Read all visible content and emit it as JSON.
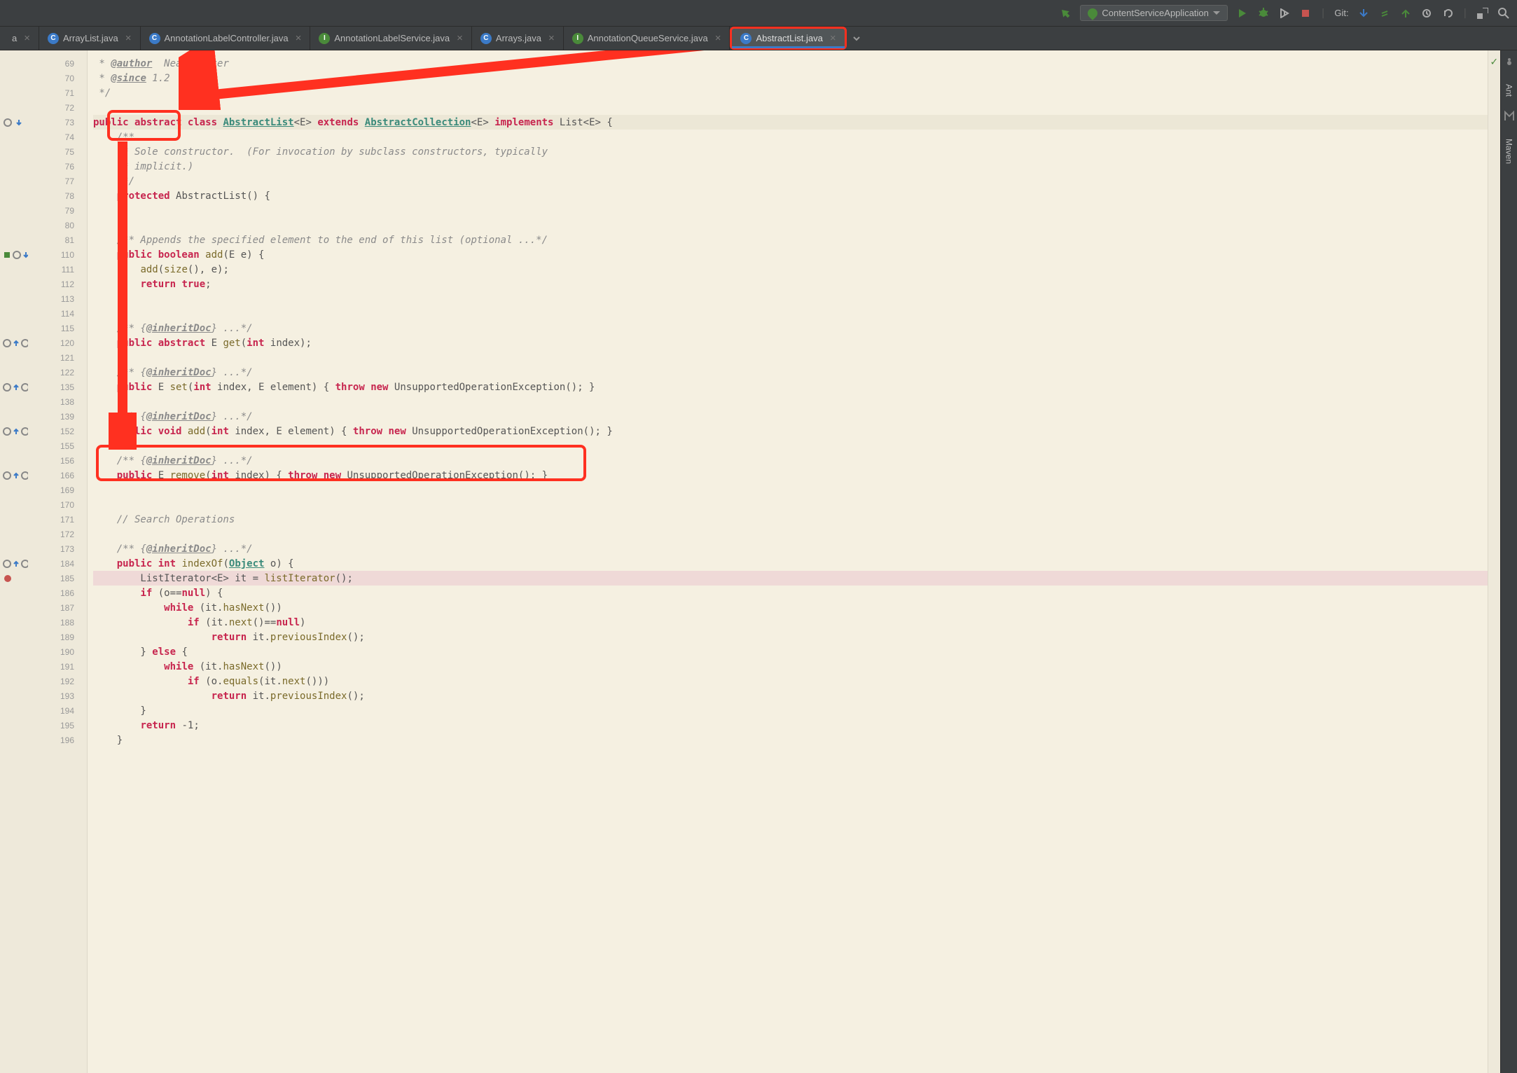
{
  "toolbar": {
    "run_config": "ContentServiceApplication",
    "git_label": "Git:"
  },
  "tabs": [
    {
      "icon": "c",
      "label": "a"
    },
    {
      "icon": "c",
      "label": "ArrayList.java"
    },
    {
      "icon": "c",
      "label": "AnnotationLabelController.java"
    },
    {
      "icon": "i",
      "label": "AnnotationLabelService.java"
    },
    {
      "icon": "c",
      "label": "Arrays.java"
    },
    {
      "icon": "i",
      "label": "AnnotationQueueService.java"
    },
    {
      "icon": "c",
      "label": "AbstractList.java"
    }
  ],
  "sidebar": {
    "ant": "Ant",
    "maven": "Maven"
  },
  "line_numbers": [
    69,
    70,
    71,
    72,
    73,
    74,
    75,
    76,
    77,
    78,
    79,
    80,
    81,
    110,
    111,
    112,
    113,
    114,
    115,
    120,
    121,
    122,
    135,
    138,
    139,
    152,
    155,
    156,
    166,
    169,
    170,
    171,
    172,
    173,
    184,
    185,
    186,
    187,
    188,
    189,
    190,
    191,
    192,
    193,
    194,
    195,
    196
  ],
  "code": {
    "l69_pre": " * ",
    "l69_tag": "@author",
    "l69_post": "  Neal Gafter",
    "l70_pre": " * ",
    "l70_tag": "@since",
    "l70_post": " 1.2",
    "l71": " */",
    "l73_public": "public ",
    "l73_abstract": "abstract ",
    "l73_class": "class ",
    "l73_AbstractList": "AbstractList",
    "l73_generic1": "<E> ",
    "l73_extends": "extends ",
    "l73_AbstractCollection": "AbstractCollection",
    "l73_generic2": "<E> ",
    "l73_implements": "implements ",
    "l73_List": "List",
    "l73_end": "<E> {",
    "l74": "    /**",
    "l75": "     * Sole constructor.  (For invocation by subclass constructors, typically",
    "l76": "     * implicit.)",
    "l77": "     */",
    "l78_prot": "    protected ",
    "l78_rest": "AbstractList() {",
    "l79": "    }",
    "l81": "    /** Appends the specified element to the end of this list (optional ...*/",
    "l110_pub": "    public ",
    "l110_bool": "boolean ",
    "l110_add": "add",
    "l110_rest": "(E e) {",
    "l111_pre": "        ",
    "l111_add": "add",
    "l111_paren": "(",
    "l111_size": "size",
    "l111_rest": "(), e);",
    "l112_pre": "        ",
    "l112_ret": "return ",
    "l112_true": "true",
    "l112_semi": ";",
    "l113": "    }",
    "l115": "    /** {",
    "l115_tag": "@inheritDoc",
    "l115_post": "} ...*/",
    "l120_pub": "    public ",
    "l120_abs": "abstract ",
    "l120_E": "E ",
    "l120_get": "get",
    "l120_paren": "(",
    "l120_int": "int ",
    "l120_rest": "index);",
    "l122": "    /** {",
    "l122_tag": "@inheritDoc",
    "l122_post": "} ...*/",
    "l135_pub": "    public ",
    "l135_E": "E ",
    "l135_set": "set",
    "l135_paren": "(",
    "l135_int": "int ",
    "l135_mid": "index, E element) { ",
    "l135_throw": "throw ",
    "l135_new": "new ",
    "l135_ex": "UnsupportedOperationException",
    "l135_end": "(); }",
    "l139": "    /** {",
    "l139_tag": "@inheritDoc",
    "l139_post": "} ...*/",
    "l152_pub": "    public ",
    "l152_void": "void ",
    "l152_add": "add",
    "l152_paren": "(",
    "l152_int": "int ",
    "l152_mid": "index, E element) { ",
    "l152_throw": "throw ",
    "l152_new": "new ",
    "l152_ex": "UnsupportedOperationException",
    "l152_end": "(); }",
    "l156": "    /** {",
    "l156_tag": "@inheritDoc",
    "l156_post": "} ...*/",
    "l166_pub": "    public ",
    "l166_E": "E ",
    "l166_rem": "remove",
    "l166_paren": "(",
    "l166_int": "int ",
    "l166_mid": "index) { ",
    "l166_throw": "throw ",
    "l166_new": "new ",
    "l166_ex": "UnsupportedOperationException",
    "l166_end": "(); }",
    "l171": "    // Search Operations",
    "l173": "    /** {",
    "l173_tag": "@inheritDoc",
    "l173_post": "} ...*/",
    "l184_pub": "    public ",
    "l184_int": "int ",
    "l184_idx": "indexOf",
    "l184_paren": "(",
    "l184_obj": "Object",
    "l184_rest": " o) {",
    "l185_pre": "        ListIterator<E> it = ",
    "l185_li": "listIterator",
    "l185_end": "();",
    "l186_pre": "        ",
    "l186_if": "if ",
    "l186_mid": "(o==",
    "l186_null": "null",
    "l186_end": ") {",
    "l187_pre": "            ",
    "l187_while": "while ",
    "l187_mid": "(it.",
    "l187_hn": "hasNext",
    "l187_end": "())",
    "l188_pre": "                ",
    "l188_if": "if ",
    "l188_mid": "(it.",
    "l188_next": "next",
    "l188_mid2": "()==",
    "l188_null": "null",
    "l188_end": ")",
    "l189_pre": "                    ",
    "l189_ret": "return ",
    "l189_mid": "it.",
    "l189_pi": "previousIndex",
    "l189_end": "();",
    "l190_pre": "        } ",
    "l190_else": "else ",
    "l190_end": "{",
    "l191_pre": "            ",
    "l191_while": "while ",
    "l191_mid": "(it.",
    "l191_hn": "hasNext",
    "l191_end": "())",
    "l192_pre": "                ",
    "l192_if": "if ",
    "l192_mid": "(o.",
    "l192_eq": "equals",
    "l192_mid2": "(it.",
    "l192_next": "next",
    "l192_end": "()))",
    "l193_pre": "                    ",
    "l193_ret": "return ",
    "l193_mid": "it.",
    "l193_pi": "previousIndex",
    "l193_end": "();",
    "l194": "        }",
    "l195_pre": "        ",
    "l195_ret": "return ",
    "l195_neg": "-1",
    "l195_end": ";",
    "l196": "    }"
  }
}
